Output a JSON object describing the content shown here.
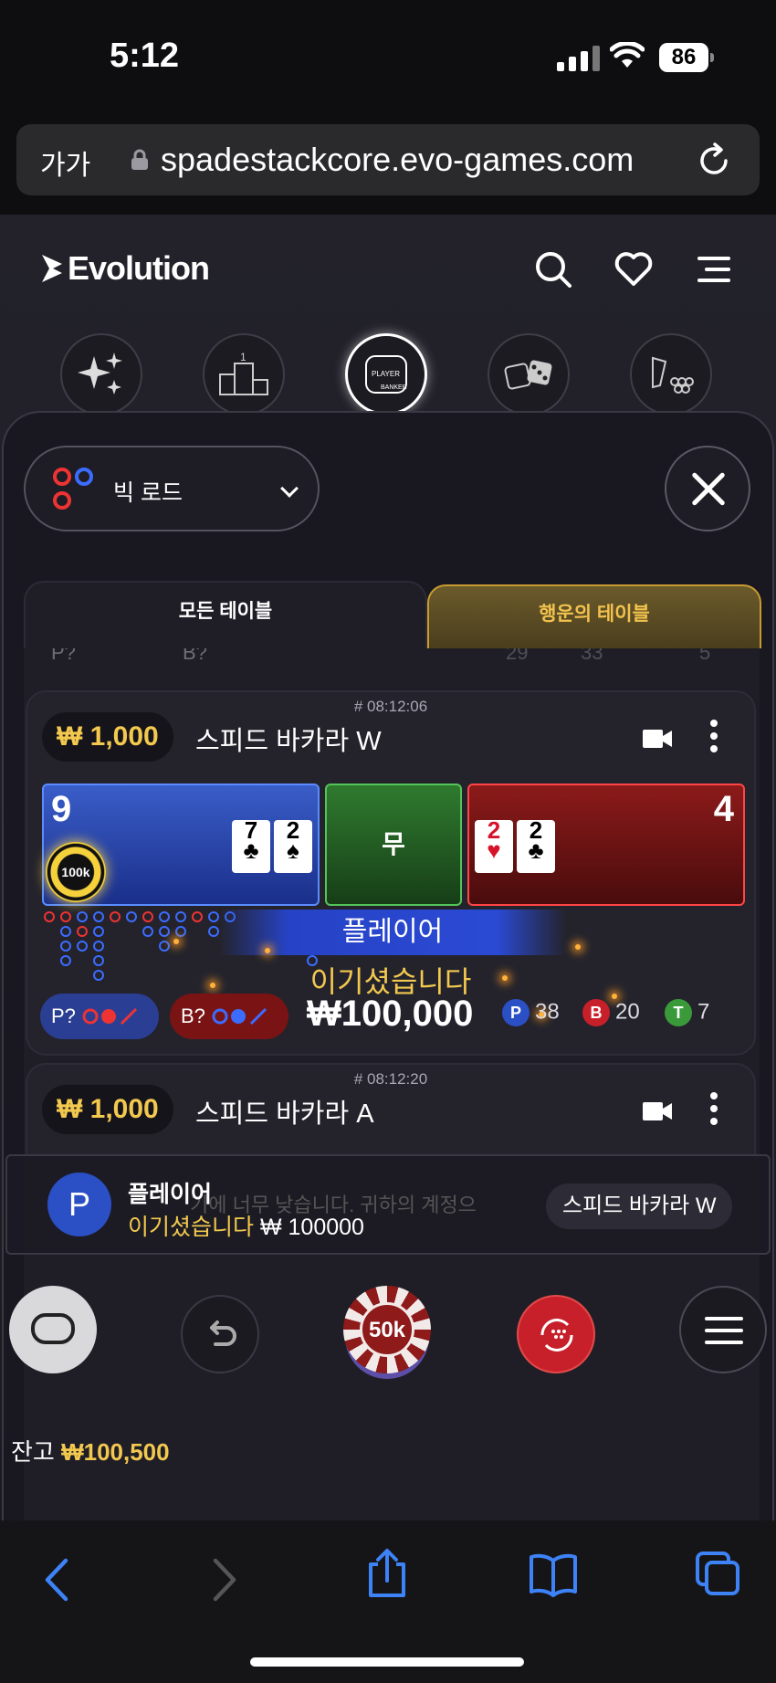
{
  "status": {
    "time": "5:12",
    "battery": "86"
  },
  "browser": {
    "aa": "가가",
    "url": "spadestackcore.evo-games.com"
  },
  "site": {
    "brand": "Evolution"
  },
  "categories": [
    "featured",
    "top-games",
    "baccarat",
    "dice",
    "other"
  ],
  "filter": {
    "road_label": "빅 로드"
  },
  "tabs": {
    "all": "모든 테이블",
    "lucky": "행운의 테이블"
  },
  "ghost_row": {
    "p": "P?",
    "b": "B?",
    "p_count": "29",
    "b_count": "33",
    "t_count": "5"
  },
  "tables": [
    {
      "timestamp": "# 08:12:06",
      "min_bet": "₩ 1,000",
      "name": "스피드 바카라 W",
      "player_score": "9",
      "banker_score": "4",
      "tie_label": "무",
      "player_cards": [
        {
          "rank": "7",
          "suit": "♣"
        },
        {
          "rank": "2",
          "suit": "♠"
        }
      ],
      "banker_cards": [
        {
          "rank": "2",
          "suit": "♥"
        },
        {
          "rank": "2",
          "suit": "♣"
        }
      ],
      "chip": "100k",
      "result_banner": "플레이어",
      "win_text": "이기셨습니다",
      "win_amount": "₩100,000",
      "pill_p": "P?",
      "pill_b": "B?",
      "stats": {
        "p_label": "P",
        "p": "38",
        "b_label": "B",
        "b": "20",
        "t_label": "T",
        "t": "7"
      }
    },
    {
      "timestamp": "# 08:12:20",
      "min_bet": "₩ 1,000",
      "name": "스피드 바카라 A"
    }
  ],
  "notification": {
    "avatar": "P",
    "title": "플레이어",
    "win_label": "이기셨습니다",
    "amount": "₩ 100000",
    "bg_text": "기에 너무 낮습니다. 귀하의 계정으",
    "table": "스피드 바카라 W"
  },
  "controls": {
    "chip": "50k"
  },
  "balance": {
    "label": "잔고",
    "amount": "₩100,500"
  },
  "colors": {
    "gold": "#f2c84e",
    "player_blue": "#2b4fc4",
    "banker_red": "#c8202a",
    "tie_green": "#2f7a2f"
  }
}
